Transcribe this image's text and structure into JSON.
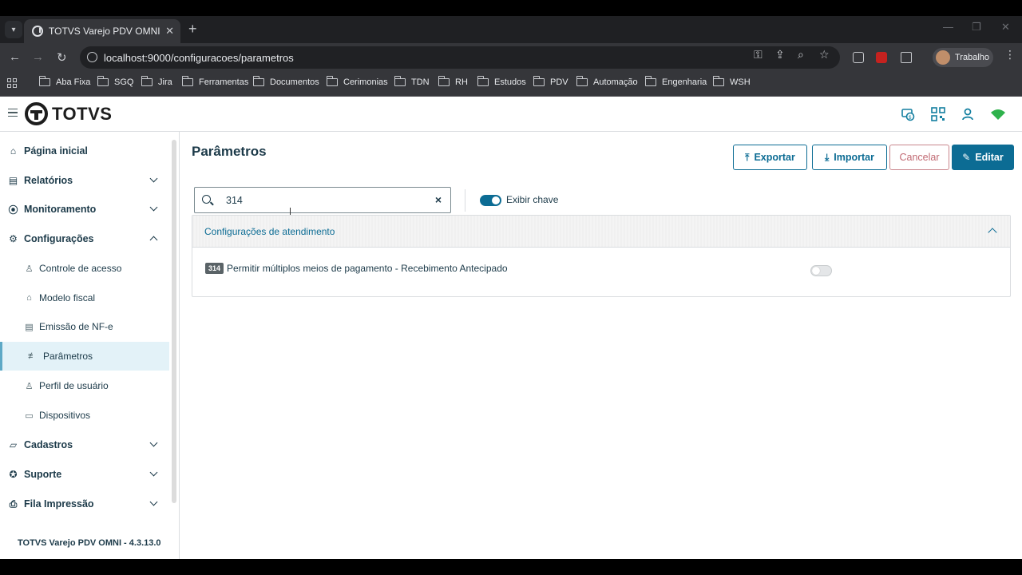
{
  "browser": {
    "tab_title": "TOTVS Varejo PDV OMNI",
    "url": "localhost:9000/configuracoes/parametros",
    "profile_name": "Trabalho",
    "bookmarks": [
      "Aba Fixa",
      "SGQ",
      "Jira",
      "Ferramentas",
      "Documentos",
      "Cerimonias",
      "TDN",
      "RH",
      "Estudos",
      "PDV",
      "Automação",
      "Engenharia",
      "WSH"
    ]
  },
  "app": {
    "logo_text": "TOTVS",
    "version_label": "TOTVS Varejo PDV OMNI - 4.3.13.0"
  },
  "sidebar": {
    "items": [
      {
        "label": "Página inicial",
        "icon": "home-icon"
      },
      {
        "label": "Relatórios",
        "icon": "report-icon"
      },
      {
        "label": "Monitoramento",
        "icon": "broadcast-icon"
      },
      {
        "label": "Configurações",
        "icon": "gear-icon"
      }
    ],
    "sub_items": [
      {
        "label": "Controle de acesso",
        "icon": "user-lock-icon"
      },
      {
        "label": "Modelo fiscal",
        "icon": "bank-icon"
      },
      {
        "label": "Emissão de NF-e",
        "icon": "document-icon"
      },
      {
        "label": "Parâmetros",
        "icon": "sliders-icon",
        "active": true
      },
      {
        "label": "Perfil de usuário",
        "icon": "user-icon"
      },
      {
        "label": "Dispositivos",
        "icon": "monitor-icon"
      }
    ],
    "bottom_items": [
      {
        "label": "Cadastros",
        "icon": "folder-icon"
      },
      {
        "label": "Suporte",
        "icon": "lifebuoy-icon"
      },
      {
        "label": "Fila Impressão",
        "icon": "printer-icon"
      }
    ]
  },
  "page": {
    "title": "Parâmetros",
    "buttons": {
      "export": "Exportar",
      "import": "Importar",
      "cancel": "Cancelar",
      "edit": "Editar"
    },
    "search": {
      "value": "314"
    },
    "show_key_toggle": {
      "label": "Exibir chave",
      "on": true
    },
    "group": {
      "title": "Configurações de atendimento",
      "expanded": true,
      "params": [
        {
          "key": "314",
          "label": "Permitir múltiplos meios de pagamento - Recebimento Antecipado",
          "enabled": false
        }
      ]
    }
  },
  "colors": {
    "primary": "#0c6c94",
    "text": "#1c3a49",
    "cancel": "#c16a73",
    "active_bg": "#e3f2f8",
    "status_green": "#2fb24c"
  }
}
